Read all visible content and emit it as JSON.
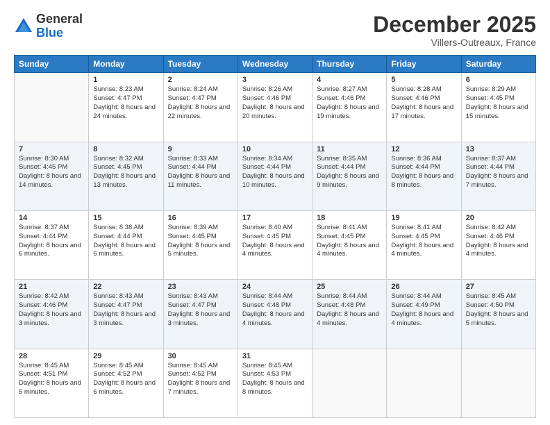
{
  "logo": {
    "general": "General",
    "blue": "Blue"
  },
  "header": {
    "month": "December 2025",
    "location": "Villers-Outreaux, France"
  },
  "weekdays": [
    "Sunday",
    "Monday",
    "Tuesday",
    "Wednesday",
    "Thursday",
    "Friday",
    "Saturday"
  ],
  "weeks": [
    [
      {
        "day": "",
        "sunrise": "",
        "sunset": "",
        "daylight": ""
      },
      {
        "day": "1",
        "sunrise": "Sunrise: 8:23 AM",
        "sunset": "Sunset: 4:47 PM",
        "daylight": "Daylight: 8 hours and 24 minutes."
      },
      {
        "day": "2",
        "sunrise": "Sunrise: 8:24 AM",
        "sunset": "Sunset: 4:47 PM",
        "daylight": "Daylight: 8 hours and 22 minutes."
      },
      {
        "day": "3",
        "sunrise": "Sunrise: 8:26 AM",
        "sunset": "Sunset: 4:46 PM",
        "daylight": "Daylight: 8 hours and 20 minutes."
      },
      {
        "day": "4",
        "sunrise": "Sunrise: 8:27 AM",
        "sunset": "Sunset: 4:46 PM",
        "daylight": "Daylight: 8 hours and 19 minutes."
      },
      {
        "day": "5",
        "sunrise": "Sunrise: 8:28 AM",
        "sunset": "Sunset: 4:46 PM",
        "daylight": "Daylight: 8 hours and 17 minutes."
      },
      {
        "day": "6",
        "sunrise": "Sunrise: 8:29 AM",
        "sunset": "Sunset: 4:45 PM",
        "daylight": "Daylight: 8 hours and 15 minutes."
      }
    ],
    [
      {
        "day": "7",
        "sunrise": "Sunrise: 8:30 AM",
        "sunset": "Sunset: 4:45 PM",
        "daylight": "Daylight: 8 hours and 14 minutes."
      },
      {
        "day": "8",
        "sunrise": "Sunrise: 8:32 AM",
        "sunset": "Sunset: 4:45 PM",
        "daylight": "Daylight: 8 hours and 13 minutes."
      },
      {
        "day": "9",
        "sunrise": "Sunrise: 8:33 AM",
        "sunset": "Sunset: 4:44 PM",
        "daylight": "Daylight: 8 hours and 11 minutes."
      },
      {
        "day": "10",
        "sunrise": "Sunrise: 8:34 AM",
        "sunset": "Sunset: 4:44 PM",
        "daylight": "Daylight: 8 hours and 10 minutes."
      },
      {
        "day": "11",
        "sunrise": "Sunrise: 8:35 AM",
        "sunset": "Sunset: 4:44 PM",
        "daylight": "Daylight: 8 hours and 9 minutes."
      },
      {
        "day": "12",
        "sunrise": "Sunrise: 8:36 AM",
        "sunset": "Sunset: 4:44 PM",
        "daylight": "Daylight: 8 hours and 8 minutes."
      },
      {
        "day": "13",
        "sunrise": "Sunrise: 8:37 AM",
        "sunset": "Sunset: 4:44 PM",
        "daylight": "Daylight: 8 hours and 7 minutes."
      }
    ],
    [
      {
        "day": "14",
        "sunrise": "Sunrise: 8:37 AM",
        "sunset": "Sunset: 4:44 PM",
        "daylight": "Daylight: 8 hours and 6 minutes."
      },
      {
        "day": "15",
        "sunrise": "Sunrise: 8:38 AM",
        "sunset": "Sunset: 4:44 PM",
        "daylight": "Daylight: 8 hours and 6 minutes."
      },
      {
        "day": "16",
        "sunrise": "Sunrise: 8:39 AM",
        "sunset": "Sunset: 4:45 PM",
        "daylight": "Daylight: 8 hours and 5 minutes."
      },
      {
        "day": "17",
        "sunrise": "Sunrise: 8:40 AM",
        "sunset": "Sunset: 4:45 PM",
        "daylight": "Daylight: 8 hours and 4 minutes."
      },
      {
        "day": "18",
        "sunrise": "Sunrise: 8:41 AM",
        "sunset": "Sunset: 4:45 PM",
        "daylight": "Daylight: 8 hours and 4 minutes."
      },
      {
        "day": "19",
        "sunrise": "Sunrise: 8:41 AM",
        "sunset": "Sunset: 4:45 PM",
        "daylight": "Daylight: 8 hours and 4 minutes."
      },
      {
        "day": "20",
        "sunrise": "Sunrise: 8:42 AM",
        "sunset": "Sunset: 4:46 PM",
        "daylight": "Daylight: 8 hours and 4 minutes."
      }
    ],
    [
      {
        "day": "21",
        "sunrise": "Sunrise: 8:42 AM",
        "sunset": "Sunset: 4:46 PM",
        "daylight": "Daylight: 8 hours and 3 minutes."
      },
      {
        "day": "22",
        "sunrise": "Sunrise: 8:43 AM",
        "sunset": "Sunset: 4:47 PM",
        "daylight": "Daylight: 8 hours and 3 minutes."
      },
      {
        "day": "23",
        "sunrise": "Sunrise: 8:43 AM",
        "sunset": "Sunset: 4:47 PM",
        "daylight": "Daylight: 8 hours and 3 minutes."
      },
      {
        "day": "24",
        "sunrise": "Sunrise: 8:44 AM",
        "sunset": "Sunset: 4:48 PM",
        "daylight": "Daylight: 8 hours and 4 minutes."
      },
      {
        "day": "25",
        "sunrise": "Sunrise: 8:44 AM",
        "sunset": "Sunset: 4:48 PM",
        "daylight": "Daylight: 8 hours and 4 minutes."
      },
      {
        "day": "26",
        "sunrise": "Sunrise: 8:44 AM",
        "sunset": "Sunset: 4:49 PM",
        "daylight": "Daylight: 8 hours and 4 minutes."
      },
      {
        "day": "27",
        "sunrise": "Sunrise: 8:45 AM",
        "sunset": "Sunset: 4:50 PM",
        "daylight": "Daylight: 8 hours and 5 minutes."
      }
    ],
    [
      {
        "day": "28",
        "sunrise": "Sunrise: 8:45 AM",
        "sunset": "Sunset: 4:51 PM",
        "daylight": "Daylight: 8 hours and 5 minutes."
      },
      {
        "day": "29",
        "sunrise": "Sunrise: 8:45 AM",
        "sunset": "Sunset: 4:52 PM",
        "daylight": "Daylight: 8 hours and 6 minutes."
      },
      {
        "day": "30",
        "sunrise": "Sunrise: 8:45 AM",
        "sunset": "Sunset: 4:52 PM",
        "daylight": "Daylight: 8 hours and 7 minutes."
      },
      {
        "day": "31",
        "sunrise": "Sunrise: 8:45 AM",
        "sunset": "Sunset: 4:53 PM",
        "daylight": "Daylight: 8 hours and 8 minutes."
      },
      {
        "day": "",
        "sunrise": "",
        "sunset": "",
        "daylight": ""
      },
      {
        "day": "",
        "sunrise": "",
        "sunset": "",
        "daylight": ""
      },
      {
        "day": "",
        "sunrise": "",
        "sunset": "",
        "daylight": ""
      }
    ]
  ]
}
